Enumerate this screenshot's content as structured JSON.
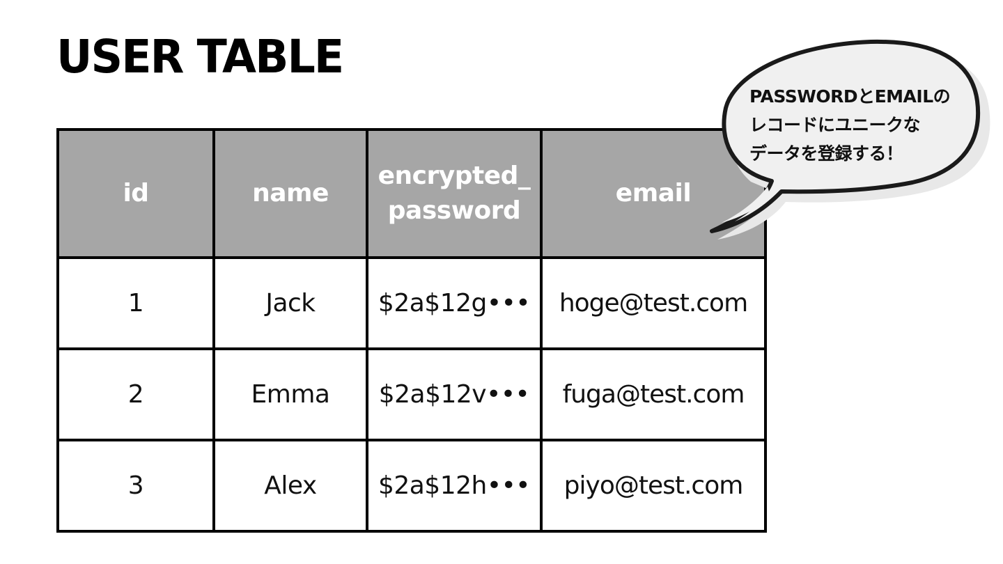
{
  "title": "USER TABLE",
  "table": {
    "headers": [
      {
        "key": "id",
        "label": "id"
      },
      {
        "key": "name",
        "label": "name"
      },
      {
        "key": "encrypted_password",
        "label_line1": "encrypted_",
        "label_line2": "password"
      },
      {
        "key": "email",
        "label": "email"
      }
    ],
    "rows": [
      {
        "id": "1",
        "name": "Jack",
        "encrypted_password": "$2a$12g•••",
        "email": "hoge@test.com"
      },
      {
        "id": "2",
        "name": "Emma",
        "encrypted_password": "$2a$12v•••",
        "email": "fuga@test.com"
      },
      {
        "id": "3",
        "name": "Alex",
        "encrypted_password": "$2a$12h•••",
        "email": "piyo@test.com"
      }
    ]
  },
  "callout": {
    "lines": [
      "PASSWORDとEMAILの",
      "レコードにユニークな",
      "データを登録する！"
    ]
  },
  "colors": {
    "header_bg": "#a6a6a6",
    "header_text": "#ffffff",
    "border": "#000000",
    "bubble_fill": "#f0f0f0",
    "bubble_shadow": "#e6e6e6",
    "bubble_stroke": "#1a1a1a"
  }
}
